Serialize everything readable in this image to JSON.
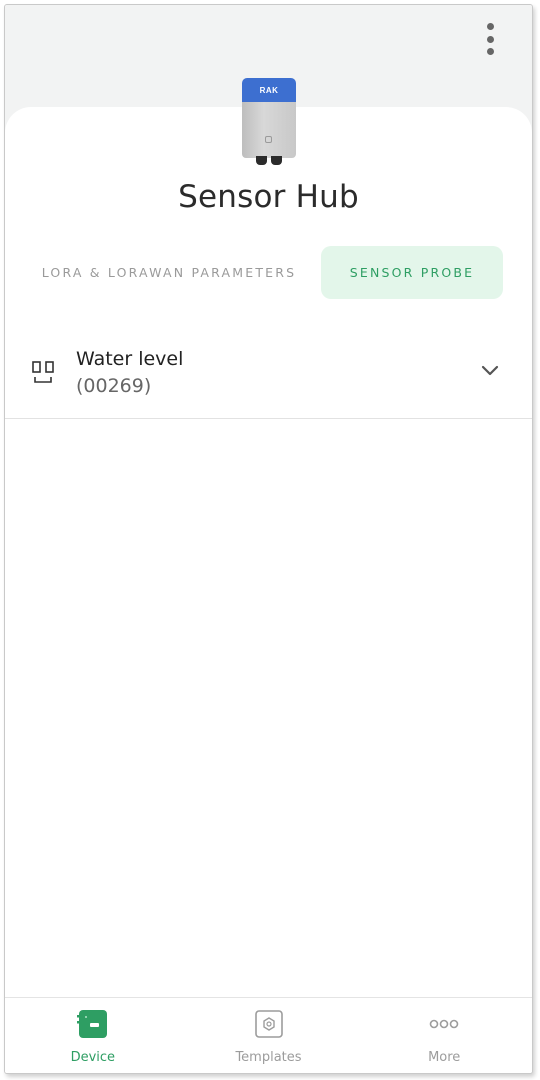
{
  "header": {
    "menu_icon": "more-vertical-icon"
  },
  "device": {
    "name": "Sensor Hub",
    "logo_text": "RAK",
    "image_icon": "device-image",
    "colors": {
      "top": "#3d6fd0",
      "body": "#c8c8c8"
    }
  },
  "tabs": [
    {
      "label": "LORA & LORAWAN PARAMETERS",
      "active": false
    },
    {
      "label": "SENSOR PROBE",
      "active": true
    }
  ],
  "probe": {
    "icon": "water-level-probe-icon",
    "name": "Water level",
    "id": "(00269)",
    "expand_icon": "chevron-down-icon"
  },
  "bottom_nav": [
    {
      "label": "Device",
      "icon": "device-icon",
      "active": true
    },
    {
      "label": "Templates",
      "icon": "templates-icon",
      "active": false
    },
    {
      "label": "More",
      "icon": "more-horizontal-icon",
      "active": false
    }
  ],
  "colors": {
    "accent": "#2e9e63",
    "accent_bg": "#e3f6ea",
    "inactive": "#9c9c9c"
  }
}
